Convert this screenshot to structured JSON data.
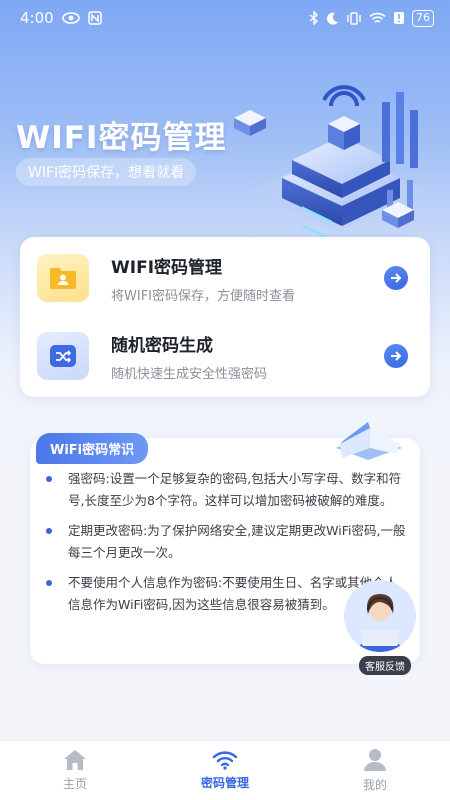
{
  "status_bar": {
    "time": "4:00",
    "battery": "76"
  },
  "hero": {
    "title": "WIFI密码管理",
    "subtitle": "WIFI密码保存，想看就看"
  },
  "features": [
    {
      "title": "WIFI密码管理",
      "desc": "将WIFI密码保存，方便随时查看",
      "icon": "folder-user-icon"
    },
    {
      "title": "随机密码生成",
      "desc": "随机快速生成安全性强密码",
      "icon": "shuffle-icon"
    }
  ],
  "tips": {
    "title": "WiFi密码常识",
    "items": [
      "强密码:设置一个足够复杂的密码,包括大小写字母、数字和符号,长度至少为8个字符。这样可以增加密码被破解的难度。",
      "定期更改密码:为了保护网络安全,建议定期更改WiFi密码,一般每三个月更改一次。",
      "不要使用个人信息作为密码:不要使用生日、名字或其他个人信息作为WiFi密码,因为这些信息很容易被猜到。"
    ]
  },
  "customer_service": {
    "label": "客服反馈"
  },
  "tab_bar": {
    "items": [
      {
        "label": "主页",
        "icon": "home-icon",
        "active": false
      },
      {
        "label": "密码管理",
        "icon": "wifi-icon",
        "active": true
      },
      {
        "label": "我的",
        "icon": "user-icon",
        "active": false
      }
    ]
  },
  "colors": {
    "accent": "#3a67e3",
    "hero_top": "#7ea8f4",
    "tab_inactive": "#9aa0aa"
  }
}
